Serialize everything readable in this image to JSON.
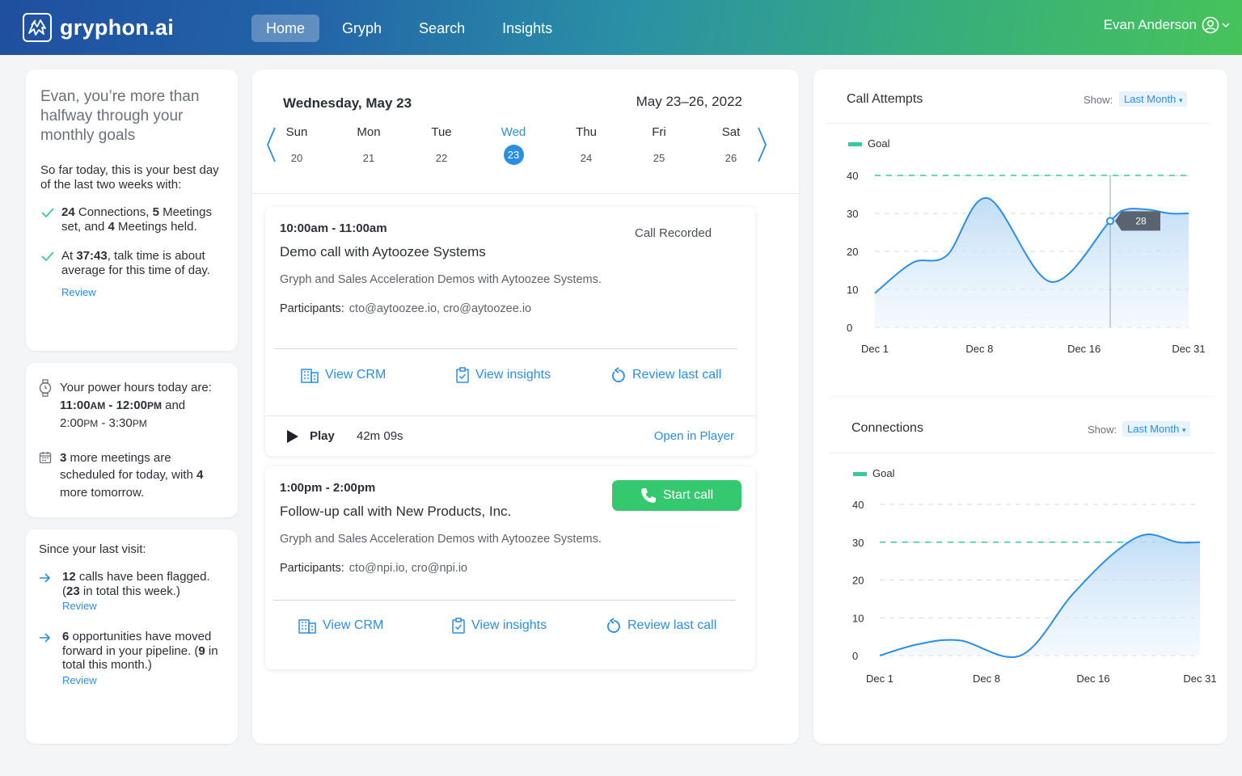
{
  "brand": {
    "name": "gryphon.ai"
  },
  "nav": {
    "items": [
      "Home",
      "Gryph",
      "Search",
      "Insights"
    ],
    "active": 0
  },
  "user": {
    "name": "Evan Anderson"
  },
  "goals": {
    "title": "Evan, you’re more than halfway through your monthly goals",
    "intro": "So far today, this is your best day of the last two weeks with:",
    "item1": {
      "n1": "24",
      "t1": " Connections, ",
      "n2": "5",
      "t2": " Meetings set, and ",
      "n3": "4",
      "t3": " Meetings held."
    },
    "item2": {
      "t0": "At ",
      "n1": "37:43",
      "t1": ", talk time is about average for this time of day."
    },
    "review": "Review"
  },
  "power": {
    "intro": "Your power hours today are:",
    "start1": "11:00",
    "ampm1": "AM",
    "sep": " - ",
    "end1": "12:00",
    "ampm2": "PM",
    "and": " and",
    "start2": "2:00",
    "ampm3": "PM",
    "end2": "3:30",
    "ampm4": "PM",
    "meetings": {
      "n1": "3",
      "t1": " more meetings are scheduled for today, with ",
      "n2": "4",
      "t2": " more tomorrow."
    }
  },
  "since": {
    "title": "Since your last visit:",
    "item1": {
      "n1": "12",
      "t1": " calls have been flagged. (",
      "n2": "23",
      "t2": " in total this week.)"
    },
    "item2": {
      "n1": "6",
      "t1": " opportunities have moved forward in your pipeline. (",
      "n2": "9",
      "t2": " in total this month.)"
    },
    "review": "Review"
  },
  "calendar": {
    "date": "Wednesday, May 23",
    "range": "May 23–26, 2022",
    "days": [
      {
        "name": "Sun",
        "num": "20"
      },
      {
        "name": "Mon",
        "num": "21"
      },
      {
        "name": "Tue",
        "num": "22"
      },
      {
        "name": "Wed",
        "num": "23"
      },
      {
        "name": "Thu",
        "num": "24"
      },
      {
        "name": "Fri",
        "num": "25"
      },
      {
        "name": "Sat",
        "num": "26"
      }
    ],
    "active_day": 3
  },
  "events": [
    {
      "time": "10:00am - 11:00am",
      "title": "Demo call with Aytoozee Systems",
      "status": "Call Recorded",
      "desc": "Gryph and Sales Acceleration Demos with Aytoozee Systems.",
      "participants_label": "Participants:",
      "participants": "cto@aytoozee.io, cro@aytoozee.io",
      "actions": [
        "View CRM",
        "View insights",
        "Review last call"
      ],
      "play_label": "Play",
      "duration": "42m 09s",
      "open_player": "Open in Player"
    },
    {
      "time": "1:00pm - 2:00pm",
      "title": "Follow-up call with New Products, Inc.",
      "start_call": "Start call",
      "desc": "Gryph and Sales Acceleration Demos with Aytoozee Systems.",
      "participants_label": "Participants:",
      "participants": "cto@npi.io, cro@npi.io",
      "actions": [
        "View CRM",
        "View insights",
        "Review last call"
      ]
    }
  ],
  "charts": {
    "show_label": "Show:",
    "show_value": "Last Month"
  },
  "colors": {
    "accent": "#2a8ee6",
    "goal": "#35c9a0",
    "start_call": "#35c96f"
  },
  "chart_data": [
    {
      "type": "area",
      "title": "Call Attempts",
      "legend": [
        "Goal"
      ],
      "x_ticks": [
        "Dec 1",
        "Dec 8",
        "Dec 16",
        "Dec 31"
      ],
      "y_ticks": [
        0,
        10,
        20,
        30,
        40
      ],
      "ylim": [
        0,
        40
      ],
      "goal": 40,
      "x": [
        0,
        0.12,
        0.23,
        0.36,
        0.56,
        0.75,
        0.8,
        0.87,
        0.94,
        1.0
      ],
      "y": [
        9,
        17,
        19,
        34,
        12,
        28,
        31,
        31,
        30,
        30
      ],
      "tooltip": {
        "x": 0.75,
        "y": 28,
        "label": "28"
      }
    },
    {
      "type": "area",
      "title": "Connections",
      "legend": [
        "Goal"
      ],
      "x_ticks": [
        "Dec 1",
        "Dec 8",
        "Dec 16",
        "Dec 31"
      ],
      "y_ticks": [
        0,
        10,
        20,
        30,
        40
      ],
      "ylim": [
        0,
        40
      ],
      "goal": 30,
      "x": [
        0,
        0.12,
        0.25,
        0.44,
        0.6,
        0.73,
        0.83,
        0.93,
        1.0
      ],
      "y": [
        0,
        3,
        4,
        0,
        16,
        27,
        32,
        30,
        30
      ]
    }
  ]
}
